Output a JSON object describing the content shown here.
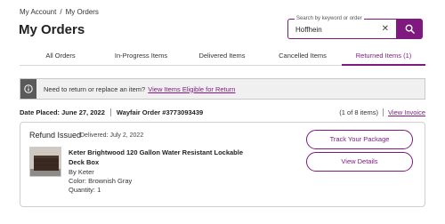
{
  "breadcrumb": {
    "items": [
      "My Account",
      "My Orders"
    ],
    "separator": "/"
  },
  "page_title": "My Orders",
  "search": {
    "label": "Search by keyword or order",
    "value": "Hoffhein",
    "clear_icon": "close-icon",
    "button_icon": "search-icon"
  },
  "tabs": [
    {
      "label": "All Orders",
      "active": false
    },
    {
      "label": "In-Progress Items",
      "active": false
    },
    {
      "label": "Delivered Items",
      "active": false
    },
    {
      "label": "Cancelled Items",
      "active": false
    },
    {
      "label": "Returned Items (1)",
      "active": true
    }
  ],
  "notice": {
    "icon": "info-icon",
    "text": "Need to return or replace an item?",
    "link": "View Items Eligible for Return"
  },
  "order": {
    "date_placed": "Date Placed: June 27, 2022",
    "order_number": "Wayfair Order #3773093439",
    "pagination": "(1 of 8 items)",
    "invoice_link": "View Invoice",
    "item": {
      "status": "Refund Issued",
      "delivered": "Delivered: July 2, 2022",
      "title": "Keter Brightwood 120 Gallon Water Resistant Lockable Deck Box",
      "brand": "By Keter",
      "color": "Color: Brownish Gray",
      "quantity": "Quantity: 1"
    },
    "actions": {
      "track": "Track Your Package",
      "details": "View Details"
    }
  },
  "colors": {
    "accent": "#7f187f",
    "notice_bg": "#f0f0f0",
    "notice_icon_bg": "#5a5a5a"
  }
}
